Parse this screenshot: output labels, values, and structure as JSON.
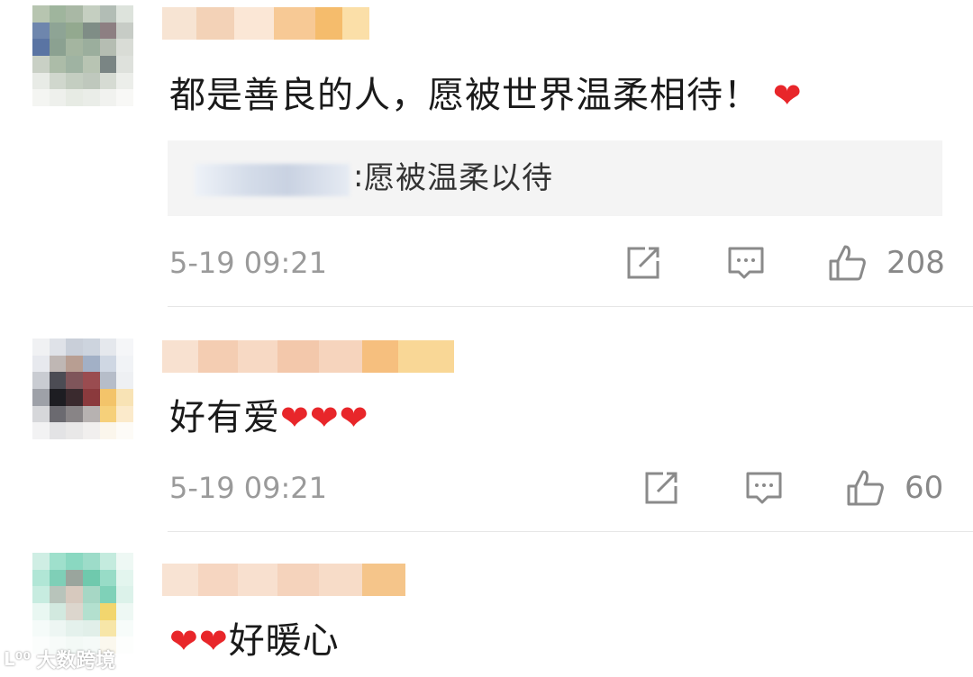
{
  "comments": [
    {
      "content": "都是善良的人，愿被世界温柔相待！",
      "hearts": "❤",
      "reply": {
        "colon": ":",
        "text": "愿被温柔以待"
      },
      "time": "5-19 09:21",
      "likes": "208",
      "icons": [
        "share-icon",
        "comment-icon",
        "like-icon"
      ]
    },
    {
      "content": "好有爱",
      "hearts": "❤❤❤",
      "time": "5-19 09:21",
      "likes": "60",
      "icons": [
        "share-icon",
        "comment-icon",
        "like-icon"
      ]
    },
    {
      "hearts": "❤❤",
      "content": "好暖心"
    }
  ],
  "watermark": {
    "logo": "L⁰⁰",
    "text": "大数跨境"
  },
  "colors": {
    "heart": "#e8262a",
    "meta": "#9a9a9a",
    "reply_bg": "#f4f4f4",
    "divider": "#e6e6e6"
  }
}
